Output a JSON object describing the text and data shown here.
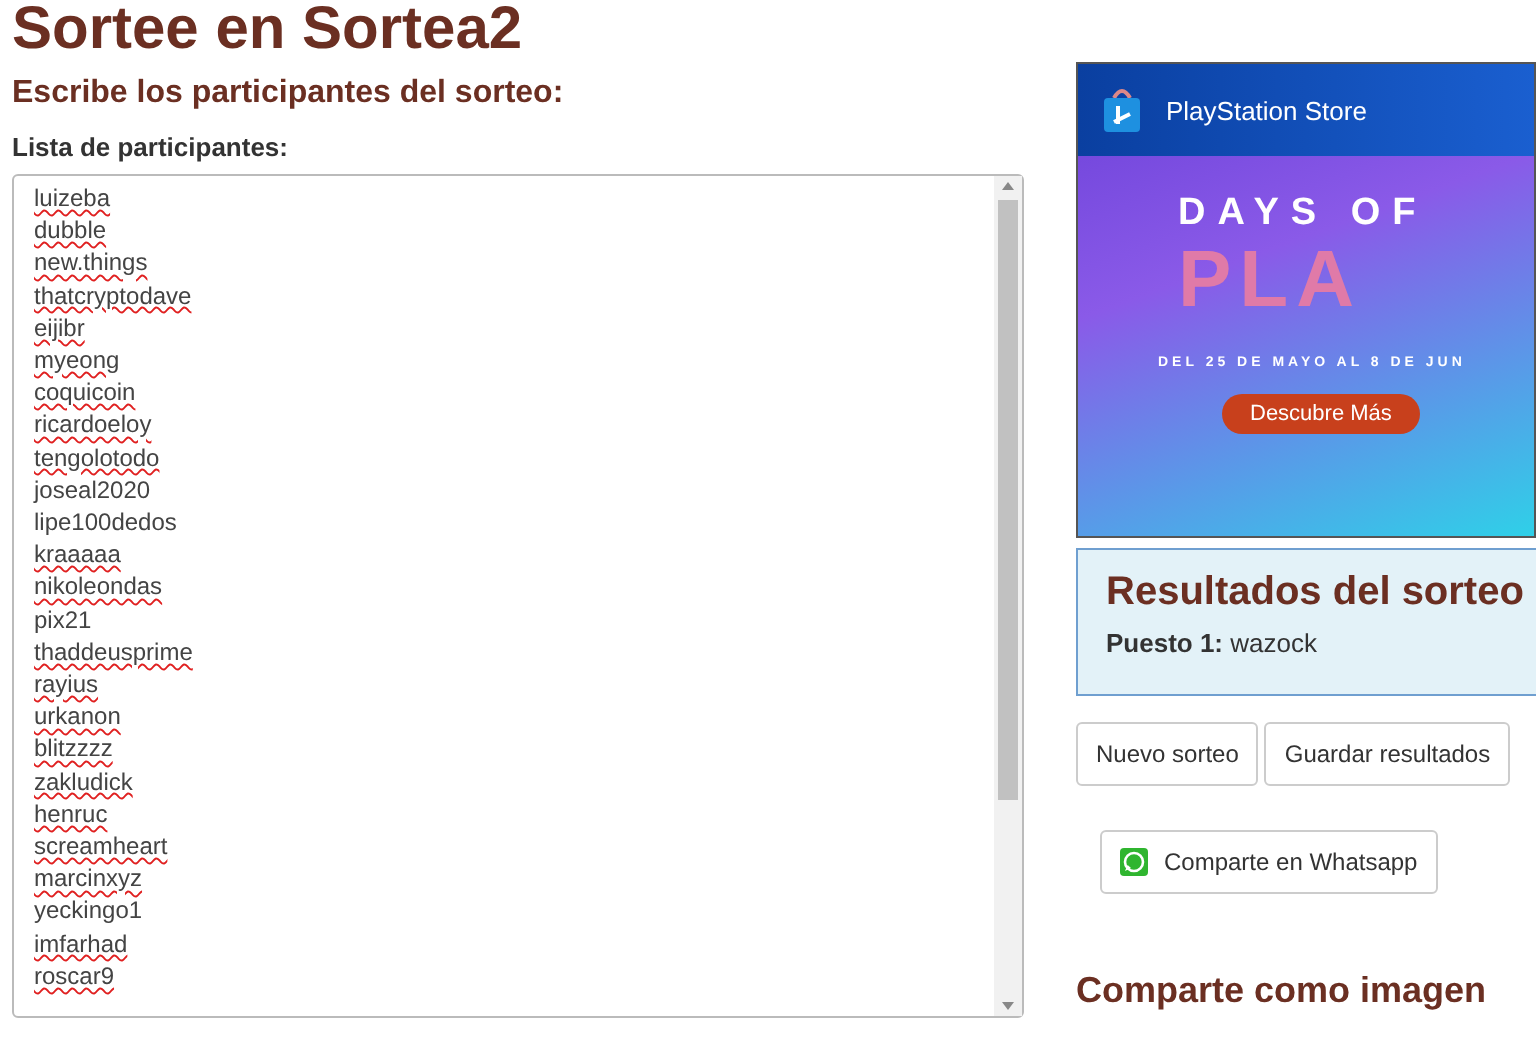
{
  "page_title": "Sortee en Sortea2",
  "form": {
    "heading": "Escribe los participantes del sorteo:",
    "list_label": "Lista de participantes:",
    "participants": [
      {
        "name": "luizeba",
        "misspelled": true
      },
      {
        "name": "dubble",
        "misspelled": true
      },
      {
        "name": "new.things",
        "misspelled": true
      },
      {
        "name": "thatcryptodave",
        "misspelled": true
      },
      {
        "name": "eijibr",
        "misspelled": true
      },
      {
        "name": "myeong",
        "misspelled": true
      },
      {
        "name": "coquicoin",
        "misspelled": true
      },
      {
        "name": "ricardoeloy",
        "misspelled": true
      },
      {
        "name": "tengolotodo",
        "misspelled": true
      },
      {
        "name": "joseal2020",
        "misspelled": false
      },
      {
        "name": "lipe100dedos",
        "misspelled": false
      },
      {
        "name": "kraaaaa",
        "misspelled": true
      },
      {
        "name": "nikoleondas",
        "misspelled": true
      },
      {
        "name": "pix21",
        "misspelled": false
      },
      {
        "name": "thaddeusprime",
        "misspelled": true
      },
      {
        "name": "rayius",
        "misspelled": true
      },
      {
        "name": "urkanon",
        "misspelled": true
      },
      {
        "name": "blitzzzz",
        "misspelled": true
      },
      {
        "name": "zakludick",
        "misspelled": true
      },
      {
        "name": "henruc",
        "misspelled": true
      },
      {
        "name": "screamheart",
        "misspelled": true
      },
      {
        "name": "marcinxyz",
        "misspelled": true
      },
      {
        "name": "yeckingo1",
        "misspelled": false
      },
      {
        "name": "imfarhad",
        "misspelled": true
      },
      {
        "name": "roscar9",
        "misspelled": true
      }
    ]
  },
  "ad": {
    "store": "PlayStation Store",
    "headline": "DAYS OF",
    "logo_text": "PLA",
    "dates": "DEL 25 DE MAYO AL 8 DE JUN",
    "cta": "Descubre Más"
  },
  "results": {
    "heading": "Resultados del sorteo",
    "entries": [
      {
        "label": "Puesto 1:",
        "winner": "wazock"
      }
    ]
  },
  "buttons": [
    "Nuevo sorteo",
    "Guardar resultados"
  ],
  "share_button": "Comparte en Whatsapp",
  "share_heading": "Comparte como imagen"
}
